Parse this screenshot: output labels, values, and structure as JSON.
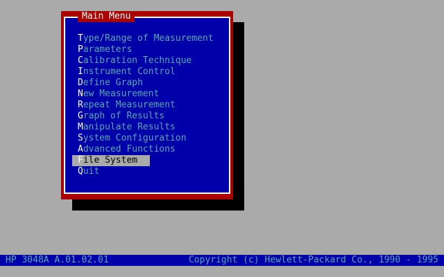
{
  "menu": {
    "title": "Main Menu",
    "items": [
      {
        "hotkey": "T",
        "rest": "ype/Range of Measurement",
        "selected": false
      },
      {
        "hotkey": "P",
        "rest": "arameters",
        "selected": false
      },
      {
        "hotkey": "C",
        "rest": "alibration Technique",
        "selected": false
      },
      {
        "hotkey": "I",
        "rest": "nstrument Control",
        "selected": false
      },
      {
        "hotkey": "D",
        "rest": "efine Graph",
        "selected": false
      },
      {
        "hotkey": "N",
        "rest": "ew Measurement",
        "selected": false
      },
      {
        "hotkey": "R",
        "rest": "epeat Measurement",
        "selected": false
      },
      {
        "hotkey": "G",
        "rest": "raph of Results",
        "selected": false
      },
      {
        "hotkey": "M",
        "rest": "anipulate Results",
        "selected": false
      },
      {
        "hotkey": "S",
        "rest": "ystem Configuration",
        "selected": false
      },
      {
        "hotkey": "A",
        "rest": "dvanced Functions",
        "selected": false
      },
      {
        "hotkey": "F",
        "rest": "ile System",
        "selected": true
      },
      {
        "hotkey": "Q",
        "rest": "uit",
        "selected": false
      }
    ]
  },
  "status_bar": {
    "left": "HP 3048A  A.01.02.01",
    "right": "Copyright (c) Hewlett-Packard Co., 1990 - 1995"
  },
  "colors": {
    "desktop": "#aaaaaa",
    "window_border": "#aa0000",
    "window_bg": "#0000aa",
    "item_text": "#55aaaa",
    "hotkey_text": "#ffffff",
    "selection_bg": "#aaaaaa"
  }
}
